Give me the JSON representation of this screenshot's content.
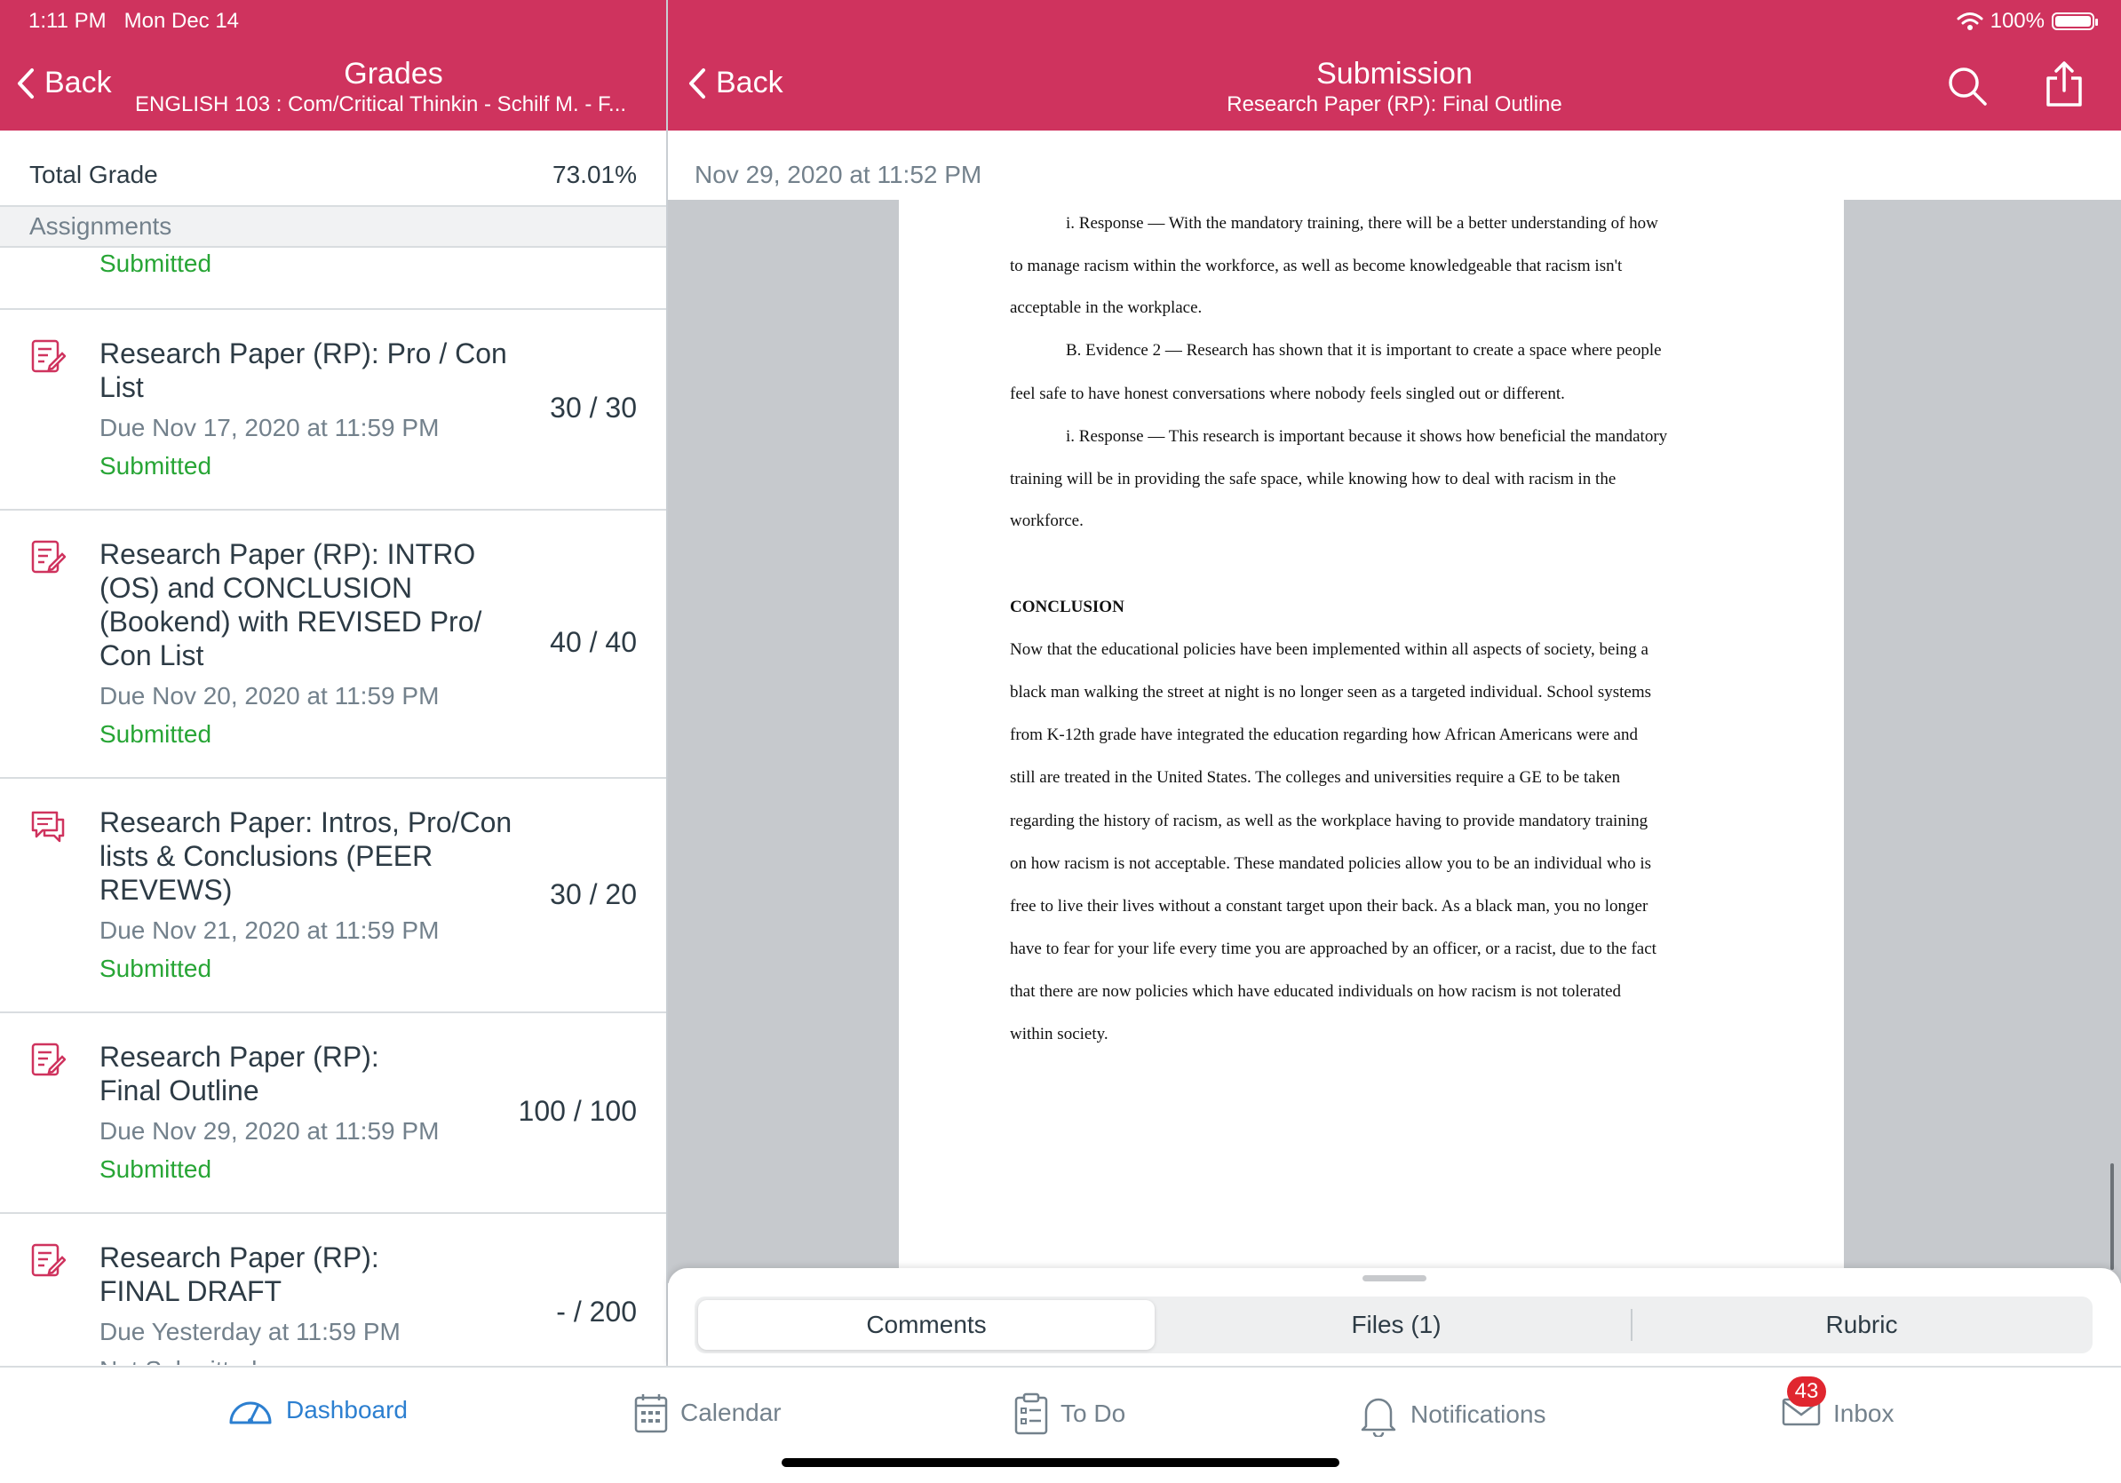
{
  "status_bar": {
    "time": "1:11 PM",
    "date": "Mon Dec 14",
    "battery": "100%"
  },
  "left_header": {
    "back_label": "Back",
    "title": "Grades",
    "subtitle": "ENGLISH 103 : Com/Critical Thinkin - Schilf M. - F..."
  },
  "right_header": {
    "back_label": "Back",
    "title": "Submission",
    "subtitle": "Research Paper (RP): Final Outline"
  },
  "grades": {
    "total_label": "Total Grade",
    "total_value": "73.01%",
    "section_label": "Assignments",
    "partial_status": "Submitted",
    "items": [
      {
        "title": "Research Paper (RP): Pro / Con List",
        "due": "Due Nov 17, 2020 at 11:59 PM",
        "status": "Submitted",
        "score": "30 / 30",
        "icon": "assignment-icon"
      },
      {
        "title": "Research Paper (RP): INTRO (OS) and CONCLUSION (Bookend) with REVISED Pro/ Con List",
        "due": "Due Nov 20, 2020 at 11:59 PM",
        "status": "Submitted",
        "score": "40 / 40",
        "icon": "assignment-icon"
      },
      {
        "title": "Research Paper: Intros, Pro/Con lists & Conclusions (PEER REVEWS)",
        "due": "Due Nov 21, 2020 at 11:59 PM",
        "status": "Submitted",
        "score": "30 / 20",
        "icon": "discussion-icon"
      },
      {
        "title": "Research Paper (RP): Final Outline",
        "due": "Due Nov 29, 2020 at 11:59 PM",
        "status": "Submitted",
        "score": "100 / 100",
        "icon": "assignment-icon"
      },
      {
        "title": "Research Paper (RP): FINAL DRAFT",
        "due": "Due Yesterday at 11:59 PM",
        "status": "Not Submitted",
        "score": "- / 200",
        "icon": "assignment-icon"
      }
    ]
  },
  "submission": {
    "date": "Nov 29, 2020 at 11:52 PM",
    "doc_lines": [
      "i. Response — With the mandatory training, there will be a better understanding of how",
      "to manage racism within the workforce, as well as become knowledgeable that racism isn't",
      "acceptable in the workplace.",
      "B. Evidence 2 — Research has shown that it is important to create a space where people",
      "feel safe to have honest conversations where nobody feels singled out or different.",
      "i. Response — This research is important because it shows how beneficial the mandatory",
      "training will be in providing the safe space, while knowing how to deal with racism in the",
      "workforce.",
      "CONCLUSION",
      "Now that the educational policies have been implemented within all aspects of society, being a",
      "black man walking the street at night is no longer seen as a targeted individual. School systems",
      "from K-12th grade have integrated the education regarding how African Americans were and",
      "still are treated in the United States. The colleges and universities require a GE to be taken",
      "regarding the history of racism, as well as the workplace having to provide mandatory training",
      "on how racism is not acceptable. These mandated policies allow you to be an individual who is",
      "free to live their lives without a constant target upon their back. As a black man, you no longer",
      "have to fear for your life every time you are approached by an officer, or a racist, due to the fact",
      "that there are now policies which have educated individuals on how racism is not tolerated",
      "within society."
    ],
    "tabs": [
      "Comments",
      "Files (1)",
      "Rubric"
    ],
    "active_tab": "Comments"
  },
  "tabbar": {
    "items": [
      {
        "label": "Dashboard",
        "icon": "dashboard-icon",
        "active": true
      },
      {
        "label": "Calendar",
        "icon": "calendar-icon"
      },
      {
        "label": "To Do",
        "icon": "todo-icon"
      },
      {
        "label": "Notifications",
        "icon": "bell-icon"
      },
      {
        "label": "Inbox",
        "icon": "inbox-icon",
        "badge": "43"
      }
    ]
  },
  "colors": {
    "brand": "#cf335e",
    "submitted": "#27a535",
    "active_tab": "#2c7fd0",
    "badge": "#e0262f"
  }
}
